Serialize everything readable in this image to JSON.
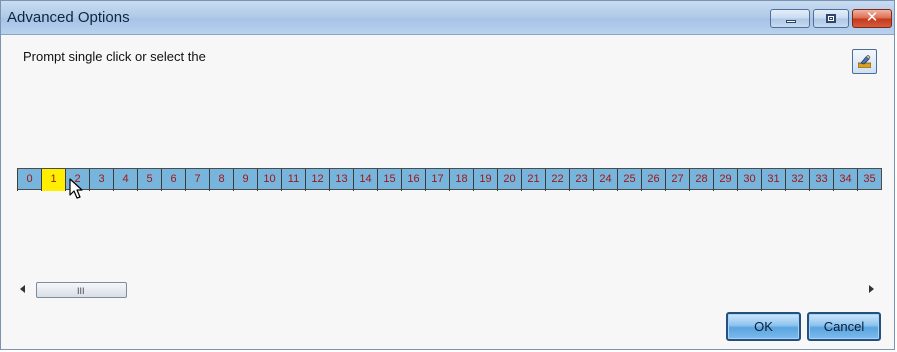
{
  "window": {
    "title": "Advanced Options",
    "minimize_label": "",
    "maximize_label": "",
    "close_label": "✕"
  },
  "content": {
    "prompt": "Prompt  single click or select the",
    "tool_icon": "brush-icon"
  },
  "ruler": {
    "cells": [
      "0",
      "1",
      "2",
      "3",
      "4",
      "5",
      "6",
      "7",
      "8",
      "9",
      "10",
      "11",
      "12",
      "13",
      "14",
      "15",
      "16",
      "17",
      "18",
      "19",
      "20",
      "21",
      "22",
      "23",
      "24",
      "25",
      "26",
      "27",
      "28",
      "29",
      "30",
      "31",
      "32",
      "33",
      "34",
      "35"
    ],
    "selected": "1"
  },
  "scrollbar": {
    "grip": "III"
  },
  "buttons": {
    "ok": "OK",
    "cancel": "Cancel"
  },
  "colors": {
    "ruler_bg": "#78b5dd",
    "selected_cell": "#ffee00",
    "cell_text": "#a31515"
  }
}
